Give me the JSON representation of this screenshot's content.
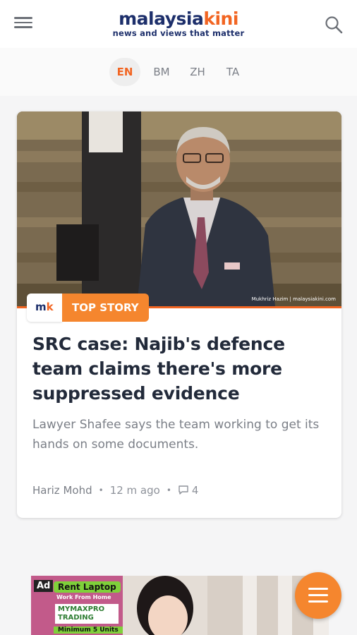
{
  "header": {
    "logo_part1": "malaysia",
    "logo_part2": "kini",
    "tagline": "news and views that matter"
  },
  "languages": [
    {
      "label": "EN",
      "active": true
    },
    {
      "label": "BM",
      "active": false
    },
    {
      "label": "ZH",
      "active": false
    },
    {
      "label": "TA",
      "active": false
    }
  ],
  "story": {
    "badge_logo_a": "m",
    "badge_logo_b": "k",
    "badge_label": "TOP STORY",
    "photo_credit": "Mukhriz Hazim | malaysiakini.com",
    "headline": "SRC case: Najib's defence team claims there's more suppressed evidence",
    "summary": "Lawyer Shafee says the team working to get its hands on some documents.",
    "author": "Hariz Mohd",
    "time_ago": "12 m ago",
    "comment_count": "4"
  },
  "ad": {
    "ad_label": "Ad",
    "title": "Rent Laptop",
    "subtitle": "Work From Home",
    "brand": "MYMAXPRO TRADING",
    "note": "Minimum 5 Units"
  },
  "colors": {
    "brand_navy": "#1d2f6b",
    "brand_orange": "#f26522",
    "badge_orange": "#f5862e"
  },
  "icons": {
    "menu": "hamburger-menu-icon",
    "search": "search-icon",
    "comment": "comment-icon",
    "fab": "hamburger-menu-icon"
  }
}
